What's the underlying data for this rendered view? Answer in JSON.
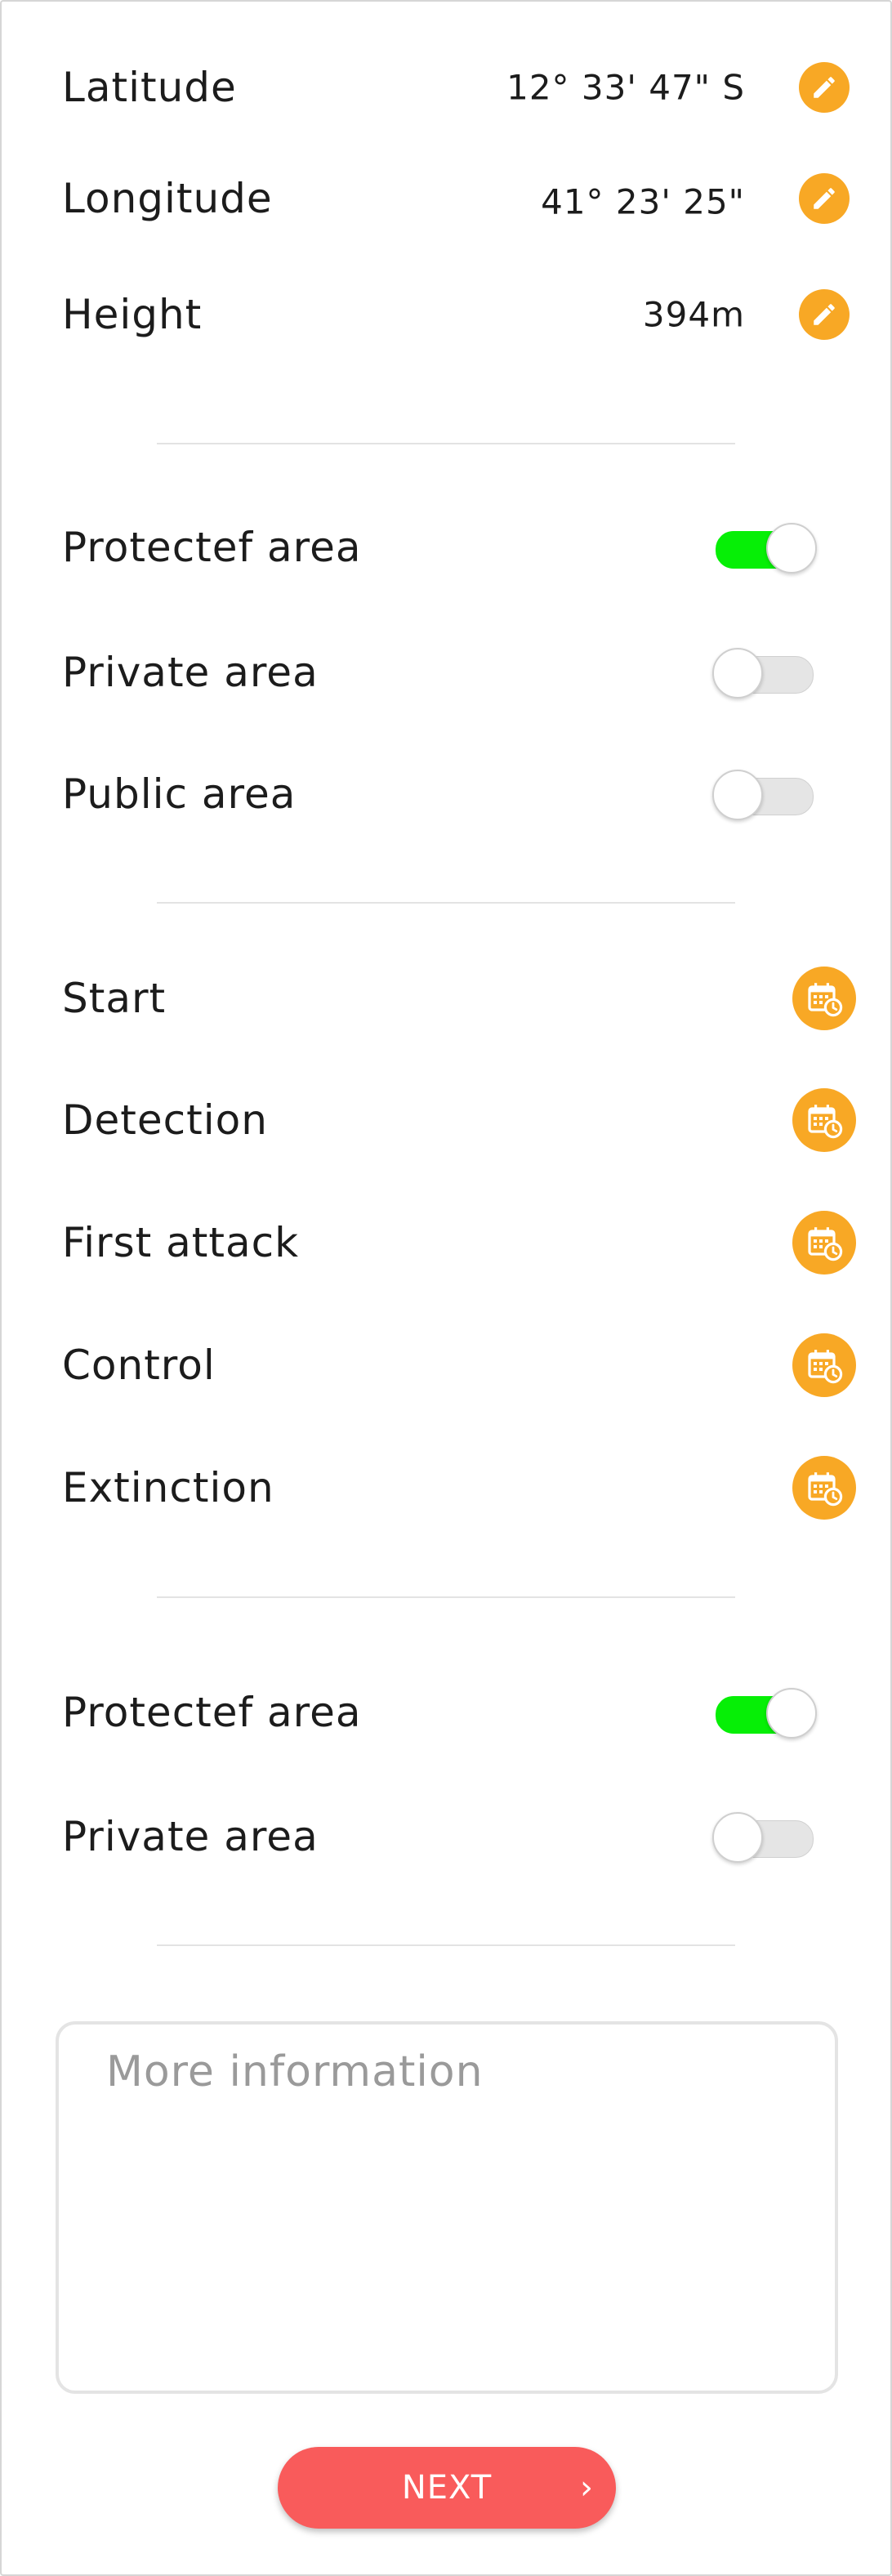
{
  "location": {
    "latitude_label": "Latitude",
    "latitude_value": "12° 33' 47\" S",
    "longitude_label": "Longitude",
    "longitude_value": "41° 23' 25\"",
    "height_label": "Height",
    "height_value": "394m"
  },
  "areas_1": [
    {
      "label": "Protectef area",
      "on": true
    },
    {
      "label": "Private area",
      "on": false
    },
    {
      "label": "Public area",
      "on": false
    }
  ],
  "events": [
    {
      "label": "Start"
    },
    {
      "label": "Detection"
    },
    {
      "label": "First attack"
    },
    {
      "label": "Control"
    },
    {
      "label": "Extinction"
    }
  ],
  "areas_2": [
    {
      "label": "Protectef area",
      "on": true
    },
    {
      "label": "Private area",
      "on": false
    }
  ],
  "more_info": {
    "placeholder": "More information"
  },
  "next_button": {
    "label": "NEXT",
    "chevron": "›"
  },
  "colors": {
    "accent": "#f8a825",
    "toggle_on": "#06ef06",
    "next": "#f95b5b"
  },
  "icons": {
    "edit": "pencil-icon",
    "schedule": "calendar-clock-icon",
    "next": "chevron-right-icon"
  }
}
